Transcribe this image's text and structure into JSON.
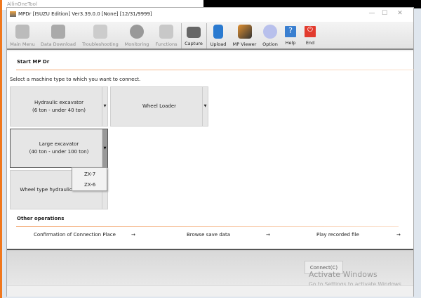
{
  "background_window": {
    "title": "AllinOneTool"
  },
  "window": {
    "title": "MPDr [ISUZU Edition] Ver3.39.0.0 [None] [12/31/9999]"
  },
  "toolbar": [
    {
      "label": "Main Menu",
      "icon": "computer-icon",
      "enabled": false
    },
    {
      "label": "Data Download",
      "icon": "download-icon",
      "enabled": false
    },
    {
      "label": "Troubleshooting",
      "icon": "stethoscope-icon",
      "enabled": false
    },
    {
      "label": "Monitoring",
      "icon": "gauge-icon",
      "enabled": false
    },
    {
      "label": "Functions",
      "icon": "functions-icon",
      "enabled": false
    },
    {
      "label": "Capture",
      "icon": "camera-icon",
      "enabled": true
    },
    {
      "label": "Upload",
      "icon": "upload-icon",
      "enabled": true
    },
    {
      "label": "MP Viewer",
      "icon": "viewer-icon",
      "enabled": true
    },
    {
      "label": "Option",
      "icon": "gear-icon",
      "enabled": true
    },
    {
      "label": "Help",
      "icon": "help-icon",
      "enabled": true
    },
    {
      "label": "End",
      "icon": "power-icon",
      "enabled": true
    }
  ],
  "start": {
    "heading": "Start MP Dr",
    "instruction": "Select a machine type to which you want to connect.",
    "machines": [
      {
        "line1": "Hydraulic excavator",
        "line2": "(6 ton - under 40 ton)"
      },
      {
        "line1": "Wheel Loader",
        "line2": ""
      },
      {
        "line1": "Large excavator",
        "line2": "(40 ton - under 100 ton)"
      },
      {
        "line1": "Wheel type hydraulic excavator",
        "line2": ""
      }
    ],
    "dropdown": [
      "ZX-7",
      "ZX-6"
    ]
  },
  "other": {
    "heading": "Other operations",
    "links": [
      "Confirmation of Connection Place",
      "Browse save data",
      "Play recorded file"
    ],
    "arrow": "→"
  },
  "connect_label": "Connect(C)",
  "watermark": {
    "title": "Activate Windows",
    "subtitle": "Go to Settings to activate Windows."
  }
}
